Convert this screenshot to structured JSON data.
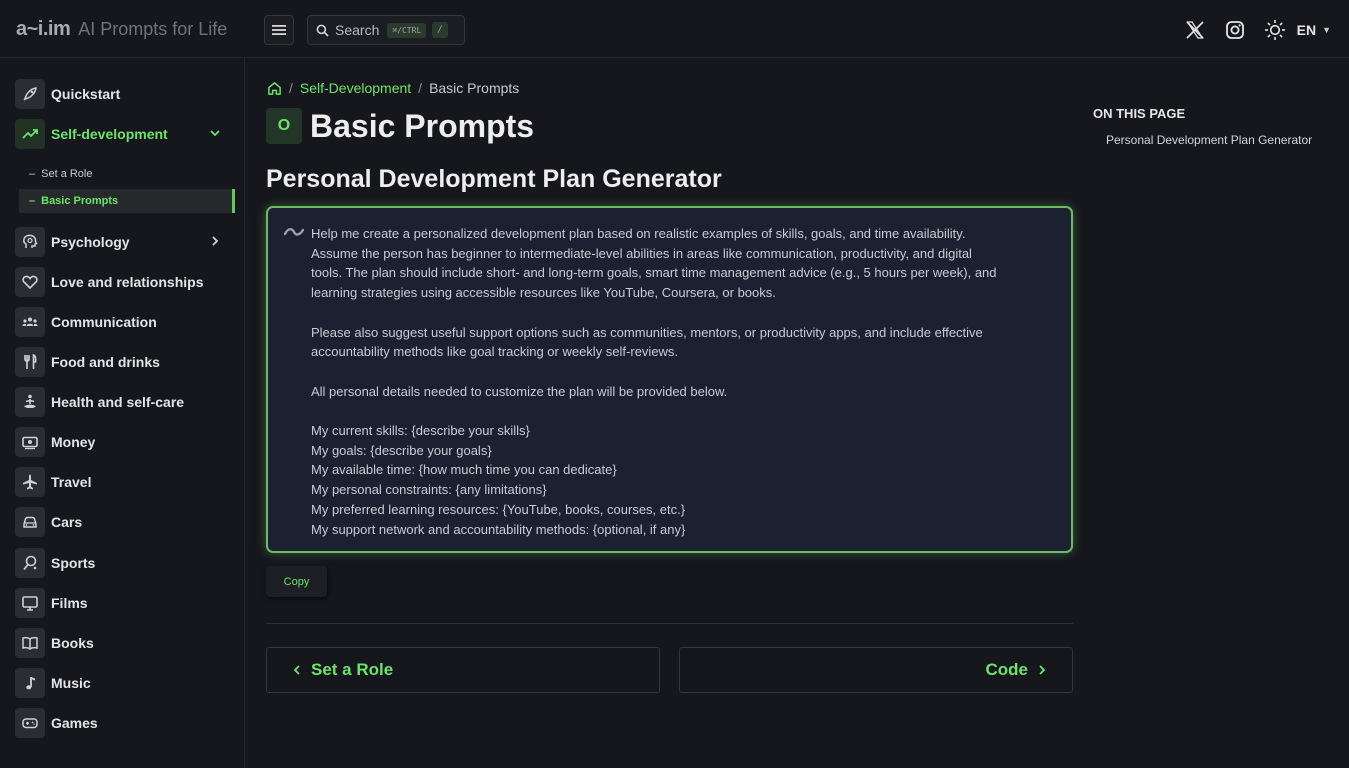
{
  "header": {
    "logo_mark": "a~i.im",
    "logo_text": "AI Prompts for Life",
    "search_label": "Search",
    "search_shortcut": "⌘/CTRL",
    "search_shortcut_key": "/",
    "language": "EN"
  },
  "sidebar": {
    "items": [
      {
        "label": "Quickstart",
        "icon": "rocket-icon"
      },
      {
        "label": "Self-development",
        "icon": "trend-icon"
      },
      {
        "label": "Psychology",
        "icon": "brain-icon"
      },
      {
        "label": "Love and relationships",
        "icon": "heart-icon"
      },
      {
        "label": "Communication",
        "icon": "people-icon"
      },
      {
        "label": "Food and drinks",
        "icon": "fork-knife-icon"
      },
      {
        "label": "Health and self-care",
        "icon": "meditation-icon"
      },
      {
        "label": "Money",
        "icon": "banknote-icon"
      },
      {
        "label": "Travel",
        "icon": "plane-icon"
      },
      {
        "label": "Cars",
        "icon": "car-icon"
      },
      {
        "label": "Sports",
        "icon": "sport-icon"
      },
      {
        "label": "Films",
        "icon": "monitor-icon"
      },
      {
        "label": "Books",
        "icon": "book-icon"
      },
      {
        "label": "Music",
        "icon": "music-note-icon"
      },
      {
        "label": "Games",
        "icon": "gamepad-icon"
      }
    ],
    "sub_items": [
      {
        "label": "Set a Role"
      },
      {
        "label": "Basic Prompts"
      }
    ]
  },
  "breadcrumb": {
    "section": "Self-Development",
    "current": "Basic Prompts"
  },
  "main": {
    "title_badge": "O",
    "page_title": "Basic Prompts",
    "section_title": "Personal Development Plan Generator",
    "prompt_text": "Help me create a personalized development plan based on realistic examples of skills, goals, and time availability.\nAssume the person has beginner to intermediate-level abilities in areas like communication, productivity, and digital\ntools. The plan should include short- and long-term goals, smart time management advice (e.g., 5 hours per week), and\nlearning strategies using accessible resources like YouTube, Coursera, or books.\n\nPlease also suggest useful support options such as communities, mentors, or productivity apps, and include effective\naccountability methods like goal tracking or weekly self-reviews.\n\nAll personal details needed to customize the plan will be provided below.\n\nMy current skills: {describe your skills}\nMy goals: {describe your goals}\nMy available time: {how much time you can dedicate}\nMy personal constraints: {any limitations}\nMy preferred learning resources: {YouTube, books, courses, etc.}\nMy support network and accountability methods: {optional, if any}",
    "copy_label": "Copy",
    "prev_label": "Set a Role",
    "next_label": "Code"
  },
  "toc": {
    "title": "ON THIS PAGE",
    "items": [
      {
        "label": "Personal Development Plan Generator"
      }
    ]
  },
  "colors": {
    "accent": "#6ee36b",
    "background": "#16171c",
    "prompt_bg": "#1b2130"
  }
}
